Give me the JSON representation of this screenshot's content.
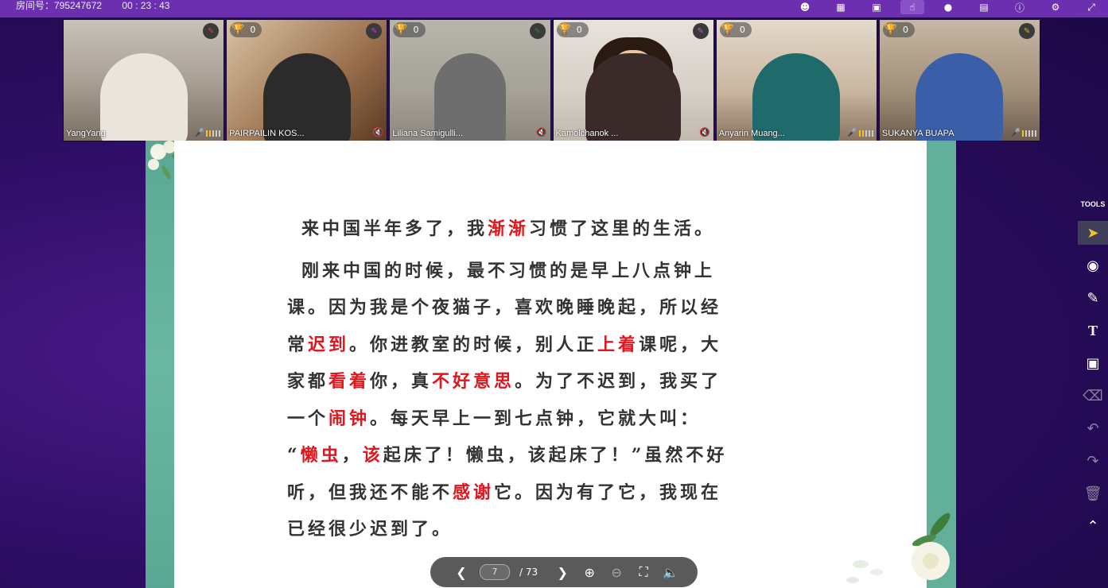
{
  "topbar": {
    "room_label": "房间号：795247672",
    "timer": "00 : 23 : 43",
    "icons": [
      "users-icon",
      "library-icon",
      "toolbox-icon",
      "hand-icon",
      "chat-icon",
      "calendar-icon",
      "info-icon",
      "settings-icon",
      "expand-icon"
    ]
  },
  "participants": [
    {
      "name": "YangYang",
      "trophy": ""
    },
    {
      "name": "PAIRPAILIN KOS...",
      "trophy": "0"
    },
    {
      "name": "Liliana Samigulli...",
      "trophy": "0"
    },
    {
      "name": "Kamolchanok ...",
      "trophy": "0"
    },
    {
      "name": "Anyarin Muang...",
      "trophy": "0"
    },
    {
      "name": "SUKANYA BUAPA",
      "trophy": "0"
    }
  ],
  "slide": {
    "line1": [
      "来中国半年多了，我",
      "渐渐",
      "习惯了这里的生活。"
    ],
    "para": [
      [
        "刚来中国的时候，最不习惯的是早上八点钟上"
      ],
      [
        "课。因为我是个夜猫子，喜欢晚睡晚起，所以经"
      ],
      [
        "常",
        "迟到",
        "。你进教室的时候，别人正",
        "上着",
        "课呢，大"
      ],
      [
        "家都",
        "看着",
        "你，真",
        "不好意思",
        "。为了不迟到，我买了"
      ],
      [
        "一个",
        "闹钟",
        "。每天早上一到七点钟，它就大叫："
      ],
      [
        "“",
        "懒虫",
        "，",
        "该",
        "起床了！懒虫，该起床了！”虽然不好"
      ],
      [
        "听，但我还不能不",
        "感谢",
        "它。因为有了它，我现在"
      ],
      [
        "已经很少迟到了。"
      ]
    ]
  },
  "pager": {
    "current_page": "7",
    "total": "/ 73"
  },
  "tools": {
    "title": "TOOLS"
  }
}
